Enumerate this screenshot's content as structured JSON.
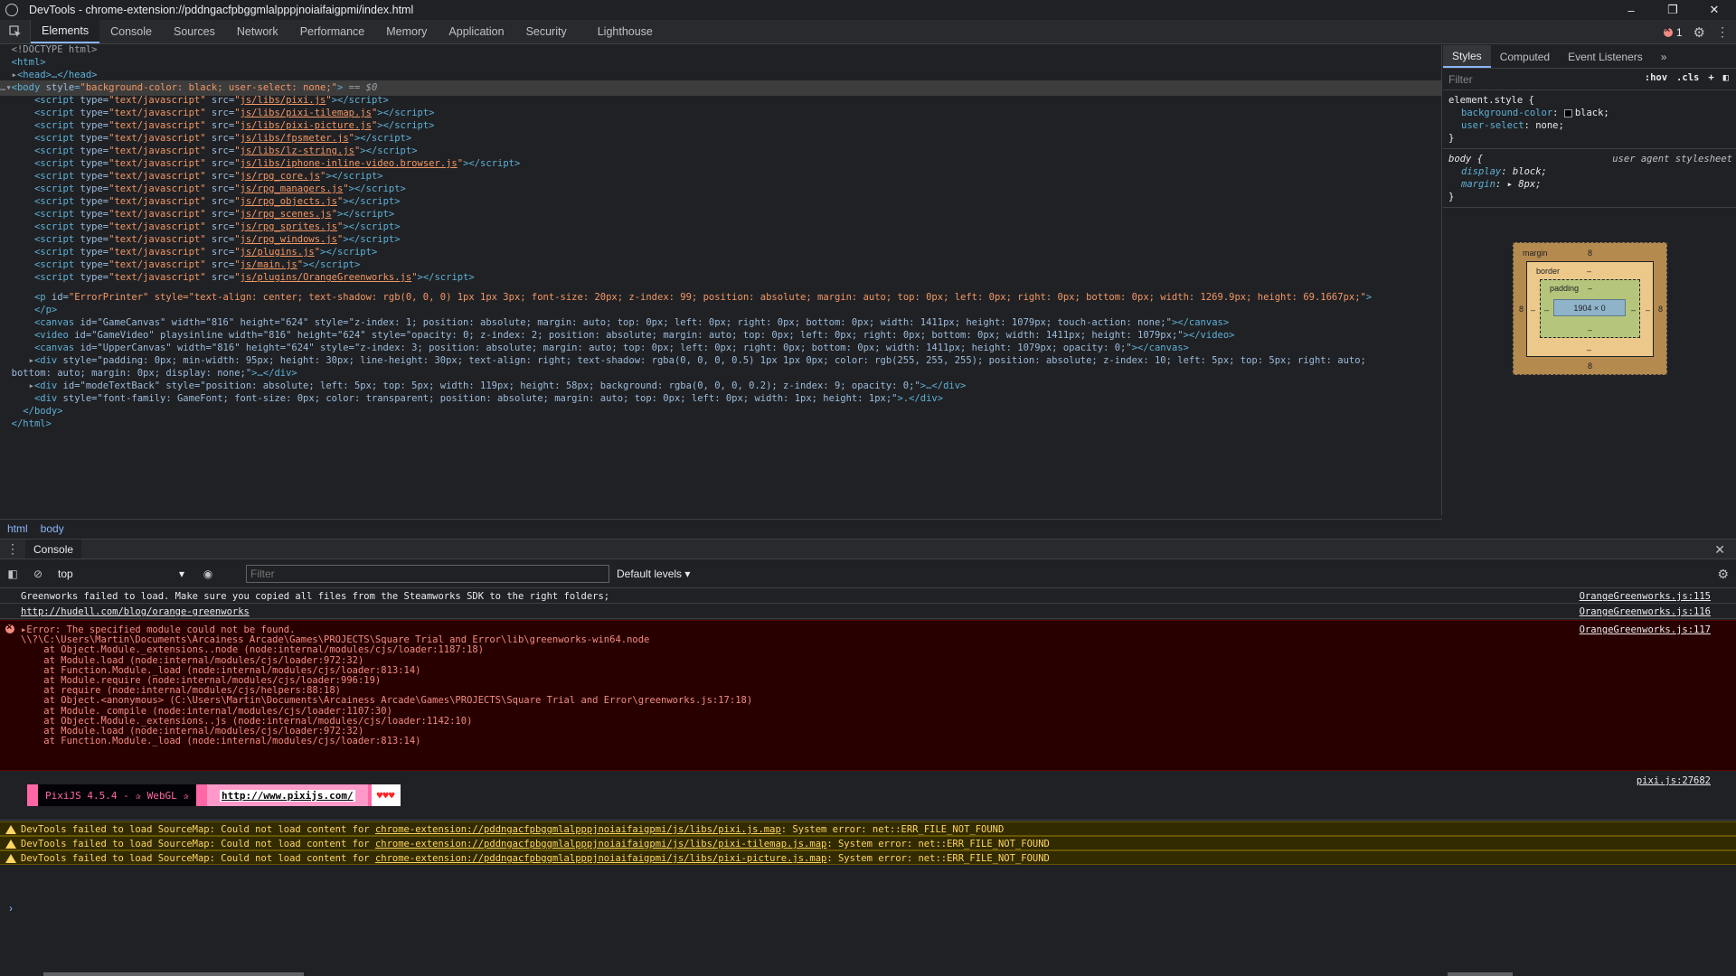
{
  "window": {
    "title": "DevTools - chrome-extension://pddngacfpbggmlalpppjnoiaifaigpmi/index.html",
    "minimize": "–",
    "restore": "❐",
    "close": "✕"
  },
  "tabs": [
    "Elements",
    "Console",
    "Sources",
    "Network",
    "Performance",
    "Memory",
    "Application",
    "Security",
    "Lighthouse"
  ],
  "active_tab": "Elements",
  "error_count": "1",
  "dom": {
    "doctype": "<!DOCTYPE html>",
    "html_open": "<html>",
    "head": "<head>…</head>",
    "body_open_prefix": "<body ",
    "body_attr": "style",
    "body_style": "\"background-color: black; user-select: none;\"",
    "body_open_suffix": ">",
    "body_marker": " == $0",
    "scripts": [
      "js/libs/pixi.js",
      "js/libs/pixi-tilemap.js",
      "js/libs/pixi-picture.js",
      "js/libs/fpsmeter.js",
      "js/libs/lz-string.js",
      "js/libs/iphone-inline-video.browser.js",
      "js/rpg_core.js",
      "js/rpg_managers.js",
      "js/rpg_objects.js",
      "js/rpg_scenes.js",
      "js/rpg_sprites.js",
      "js/rpg_windows.js",
      "js/plugins.js",
      "js/main.js",
      "js/plugins/OrangeGreenworks.js"
    ],
    "script_type": "\"text/javascript\"",
    "p_line": "\"ErrorPrinter\" style=\"text-align: center; text-shadow: rgb(0, 0, 0) 1px 1px 3px; font-size: 20px; z-index: 99; position: absolute; margin: auto; top: 0px; left: 0px; right: 0px; bottom: 0px; width: 1269.9px; height: 69.1667px;\"",
    "p_close": "</p>",
    "canvas1": "id=\"GameCanvas\" width=\"816\" height=\"624\" style=\"z-index: 1; position: absolute; margin: auto; top: 0px; left: 0px; right: 0px; bottom: 0px; width: 1411px; height: 1079px; touch-action: none;\"",
    "video": "id=\"GameVideo\" playsinline width=\"816\" height=\"624\" style=\"opacity: 0; z-index: 2; position: absolute; margin: auto; top: 0px; left: 0px; right: 0px; bottom: 0px; width: 1411px; height: 1079px;\"",
    "canvas2": "id=\"UpperCanvas\" width=\"816\" height=\"624\" style=\"z-index: 3; position: absolute; margin: auto; top: 0px; left: 0px; right: 0px; bottom: 0px; width: 1411px; height: 1079px; opacity: 0;\"",
    "div1_a": "style=\"padding: 0px; min-width: 95px; height: 30px; line-height: 30px; text-align: right; text-shadow: rgba(0, 0, 0, 0.5) 1px 1px 0px; color: rgb(255, 255, 255); position: absolute; z-index: 10; left: 5px; top: 5px; right: auto;",
    "div1_b": "bottom: auto; margin: 0px; display: none;\"",
    "div2": "id=\"modeTextBack\" style=\"position: absolute; left: 5px; top: 5px; width: 119px; height: 58px; background: rgba(0, 0, 0, 0.2); z-index: 9; opacity: 0;\"",
    "div3": "style=\"font-family: GameFont; font-size: 0px; color: transparent; position: absolute; margin: auto; top: 0px; left: 0px; width: 1px; height: 1px;\"",
    "body_close": "</body>",
    "html_close": "</html>"
  },
  "breadcrumb": [
    "html",
    "body"
  ],
  "styles": {
    "tabs": [
      "Styles",
      "Computed",
      "Event Listeners"
    ],
    "filter_placeholder": "Filter",
    "hov": ":hov",
    ".cls": ".cls",
    "element_style_selector": "element.style {",
    "bg_prop": "background-color",
    "bg_val": "black;",
    "us_prop": "user-select",
    "us_val": "none;",
    "close_brace": "}",
    "body_selector": "body {",
    "ua_source": "user agent stylesheet",
    "display_prop": "display",
    "display_val": "block;",
    "margin_prop": "margin",
    "margin_val": "8px;"
  },
  "boxmodel": {
    "margin_label": "margin",
    "margin_val": "8",
    "border_label": "border",
    "padding_label": "padding",
    "dash": "–",
    "content": "1904 × 0",
    "left_val": "8",
    "right_val": "8",
    "bottom_val": "8"
  },
  "drawer": {
    "tab": "Console",
    "context": "top",
    "filter_placeholder": "Filter",
    "levels": "Default levels ▾"
  },
  "console": {
    "msg1": "Greenworks failed to load. Make sure you copied all files from the Steamworks SDK to the right folders;",
    "msg1_loc": "OrangeGreenworks.js:115",
    "msg2": "http://hudell.com/blog/orange-greenworks",
    "msg2_loc": "OrangeGreenworks.js:116",
    "err_loc": "OrangeGreenworks.js:117",
    "err_lines": [
      "▸Error: The specified module could not be found.",
      "\\\\?\\C:\\Users\\Martin\\Documents\\Arcainess Arcade\\Games\\PROJECTS\\Square Trial and Error\\lib\\greenworks-win64.node",
      "    at Object.Module._extensions..node (node:internal/modules/cjs/loader:1187:18)",
      "    at Module.load (node:internal/modules/cjs/loader:972:32)",
      "    at Function.Module._load (node:internal/modules/cjs/loader:813:14)",
      "    at Module.require (node:internal/modules/cjs/loader:996:19)",
      "    at require (node:internal/modules/cjs/helpers:88:18)",
      "    at Object.<anonymous> (C:\\Users\\Martin\\Documents\\Arcainess Arcade\\Games\\PROJECTS\\Square Trial and Error\\greenworks.js:17:18)",
      "    at Module._compile (node:internal/modules/cjs/loader:1107:30)",
      "    at Object.Module._extensions..js (node:internal/modules/cjs/loader:1142:10)",
      "    at Module.load (node:internal/modules/cjs/loader:972:32)",
      "    at Function.Module._load (node:internal/modules/cjs/loader:813:14)"
    ],
    "pixi_loc": "pixi.js:27682",
    "pixi_text": " PixiJS 4.5.4 - ✰ WebGL ✰ ",
    "pixi_url": "http://www.pixijs.com/",
    "pixi_hearts": "♥♥♥",
    "warn_prefix": "DevTools failed to load SourceMap: Could not load content for ",
    "warn_suffix": ": System error: net::ERR_FILE_NOT_FOUND",
    "warn_urls": [
      "chrome-extension://pddngacfpbggmlalpppjnoiaifaigpmi/js/libs/pixi.js.map",
      "chrome-extension://pddngacfpbggmlalpppjnoiaifaigpmi/js/libs/pixi-tilemap.js.map",
      "chrome-extension://pddngacfpbggmlalpppjnoiaifaigpmi/js/libs/pixi-picture.js.map"
    ],
    "prompt": "›"
  }
}
